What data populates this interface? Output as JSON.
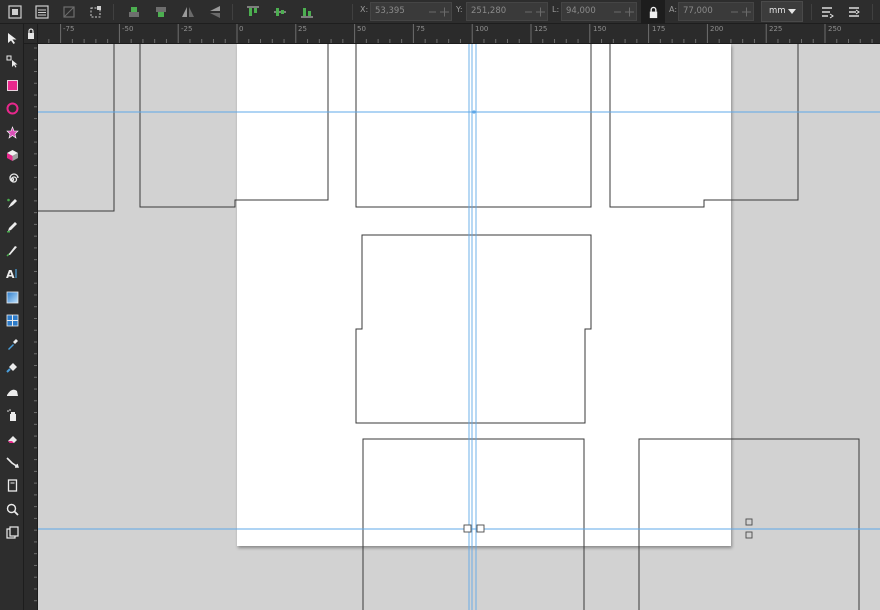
{
  "toolbar": {
    "fields": [
      {
        "label": "X:",
        "value": "53,395"
      },
      {
        "label": "Y:",
        "value": "251,280"
      },
      {
        "label": "L:",
        "value": "94,000"
      },
      {
        "label": "A:",
        "value": "77,000"
      }
    ],
    "unit": "mm",
    "left_icons": [
      "select-all-icon",
      "select-all-layers-icon",
      "deselect-icon",
      "touch-select-icon",
      "raise-to-top-icon",
      "lower-to-bottom-icon",
      "flip-horizontal-icon",
      "flip-vertical-icon",
      "align-top-icon",
      "align-middle-icon",
      "align-bottom-icon"
    ],
    "right_icons": [
      "snap-bbox-icon",
      "snap-nodes-icon"
    ]
  },
  "ruler": {
    "ticks": [
      "-75",
      "-50",
      "-25",
      "0",
      "25",
      "50",
      "75",
      "100",
      "125",
      "150",
      "175",
      "200",
      "225",
      "250"
    ]
  },
  "tools": [
    "selector-tool-icon",
    "node-tool-icon",
    "rectangle-tool-icon",
    "ellipse-tool-icon",
    "star-tool-icon",
    "3d-box-tool-icon",
    "spiral-tool-icon",
    "pen-tool-icon",
    "pencil-tool-icon",
    "calligraphy-tool-icon",
    "text-tool-icon",
    "gradient-tool-icon",
    "mesh-tool-icon",
    "dropper-tool-icon",
    "paint-bucket-tool-icon",
    "tweak-tool-icon",
    "spray-tool-icon",
    "eraser-tool-icon",
    "connector-tool-icon",
    "pages-tool-icon",
    "zoom-tool-icon",
    "measure-tool-icon"
  ],
  "colors": {
    "guide": "#5fa8e8",
    "rect_tool": "#e8288c",
    "ellipse_tool": "#e8288c",
    "star_tool": "#d94fb7",
    "accent": "#4a9fdc"
  }
}
